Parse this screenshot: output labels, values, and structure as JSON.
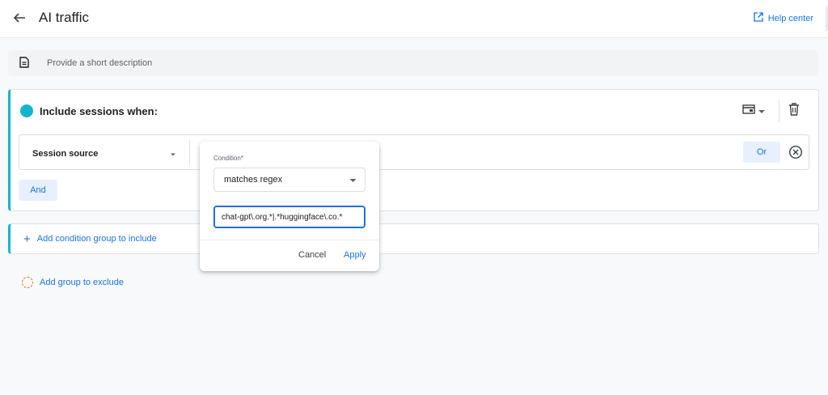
{
  "header": {
    "title": "AI traffic",
    "help_label": "Help center"
  },
  "description": {
    "placeholder": "Provide a short description"
  },
  "include_group": {
    "title": "Include sessions when:",
    "condition": {
      "dimension": "Session source",
      "or_label": "Or"
    },
    "and_label": "And"
  },
  "add_include_label": "Add condition group to include",
  "add_exclude_label": "Add group to exclude",
  "popover": {
    "condition_label": "Condition*",
    "match_type": "matches regex",
    "value": "chat-gpt\\.org.*|.*huggingface\\.co.*",
    "cancel_label": "Cancel",
    "apply_label": "Apply"
  },
  "colors": {
    "accent": "#1a73e8",
    "group": "#12b5cb",
    "exclude": "#e8710a"
  },
  "icons": [
    "back-arrow-icon",
    "open-in-new-icon",
    "document-icon",
    "table-layout-icon",
    "dropdown-arrow-icon",
    "trash-icon",
    "clear-circle-icon",
    "plus-icon",
    "dashed-circle-icon"
  ]
}
